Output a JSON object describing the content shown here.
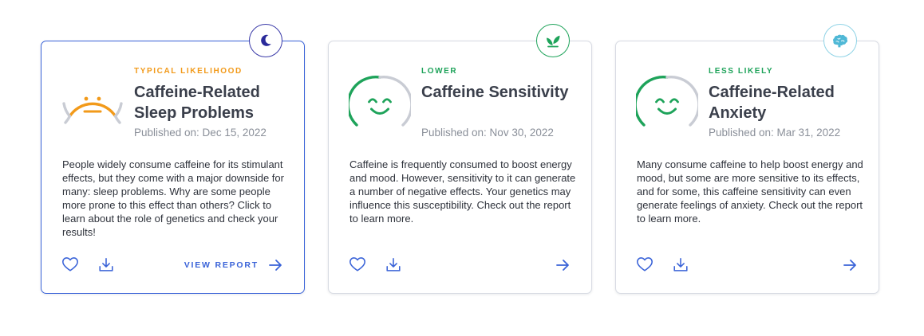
{
  "cards": [
    {
      "category": "TYPICAL LIKELIHOOD",
      "category_color": "#f29a1a",
      "title": "Caffeine-Related Sleep Problems",
      "published": "Published on: Dec 15, 2022",
      "description": "People widely consume caffeine for its stimulant effects, but they come with a major downside for many: sleep problems. Why are some people more prone to this effect than others? Click to learn about the role of genetics and check your results!",
      "badge_icon": "moon-icon",
      "face": "neutral-face-icon",
      "cta_label": "VIEW REPORT",
      "active": true
    },
    {
      "category": "LOWER",
      "category_color": "#1ea35a",
      "title": "Caffeine Sensitivity",
      "published": "Published on: Nov 30, 2022",
      "description": "Caffeine is frequently consumed to boost energy and mood. However, sensitivity to it can generate a number of negative effects. Your genetics may influence this susceptibility. Check out the report to learn more.",
      "badge_icon": "leaves-icon",
      "face": "smiling-face-icon",
      "active": false
    },
    {
      "category": "LESS LIKELY",
      "category_color": "#1ea35a",
      "title": "Caffeine-Related Anxiety",
      "published": "Published on: Mar 31, 2022",
      "description": "Many consume caffeine to help boost energy and mood, but some are more sensitive to its effects, and for some, this caffeine sensitivity can even generate feelings of anxiety. Check out the report to learn more.",
      "badge_icon": "brain-icon",
      "face": "smiling-face-icon",
      "active": false
    }
  ],
  "colors": {
    "accent": "#3a63d8",
    "moon": "#2a2a9a",
    "leaves": "#1ea35a",
    "brain": "#4fb8d6",
    "neutral": "#f29a1a",
    "positive": "#1ea35a",
    "arc_grey": "#c9ccd4"
  }
}
